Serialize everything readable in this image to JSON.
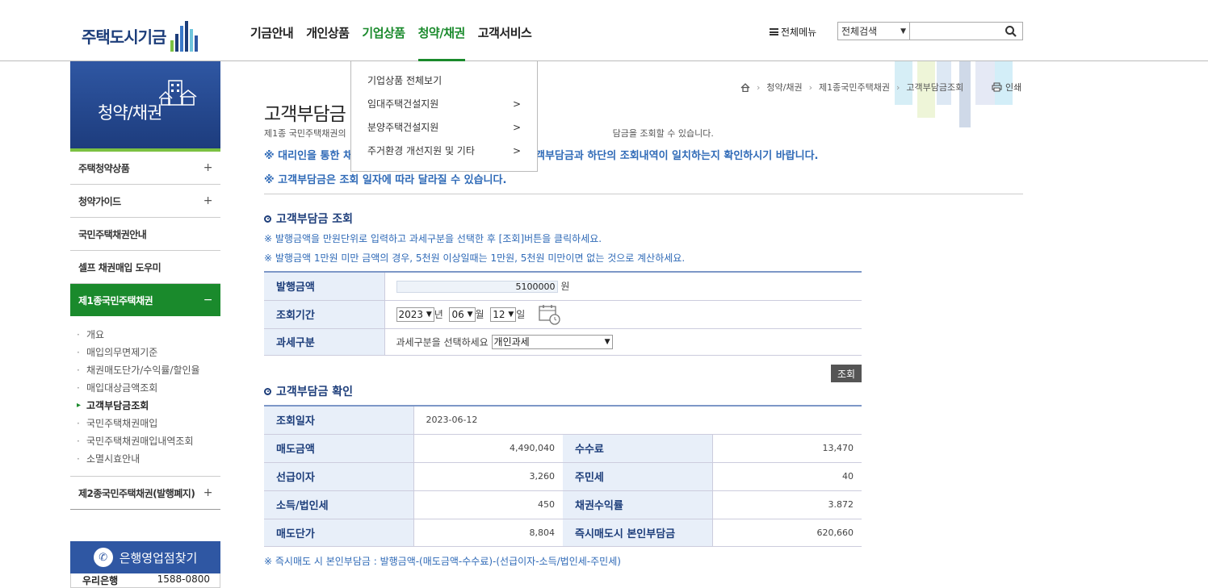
{
  "gnb": {
    "logo": "주택도시기금",
    "menu": [
      "기금안내",
      "개인상품",
      "기업상품",
      "청약/채권",
      "고객서비스"
    ],
    "allmenu": "전체메뉴",
    "search_select": "전체검색",
    "search_value": "",
    "colors": {
      "brand": "#1c3d7a",
      "accent": "#1a8a2c"
    }
  },
  "dropdown": {
    "items": [
      {
        "label": "기업상품 전체보기",
        "arrow": ""
      },
      {
        "label": "임대주택건설지원",
        "arrow": ">"
      },
      {
        "label": "분양주택건설지원",
        "arrow": ">"
      },
      {
        "label": "주거환경 개선지원 및 기타",
        "arrow": ">"
      }
    ]
  },
  "lnb": {
    "title": "청약/채권",
    "items": [
      {
        "label": "주택청약상품",
        "sign": "+"
      },
      {
        "label": "청약가이드",
        "sign": "+"
      },
      {
        "label": "국민주택채권안내",
        "sign": ""
      },
      {
        "label": "셀프 채권매입 도우미",
        "sign": ""
      }
    ],
    "active": {
      "label": "제1종국민주택채권",
      "sign": "−"
    },
    "sub": [
      "개요",
      "매입의무면제기준",
      "채권매도단가/수익률/할인율",
      "매입대상금액조회",
      "고객부담금조회",
      "국민주택채권매입",
      "국민주택채권매입내역조회",
      "소멸시효안내"
    ],
    "last": {
      "label": "제2종국민주택채권(발행폐지)",
      "sign": "+"
    }
  },
  "bank": {
    "title": "은행영업점찾기",
    "row_name": "우리은행",
    "row_phone": "1588-0800"
  },
  "breadcrumb": {
    "items": [
      "청약/채권",
      "제1종국민주택채권",
      "고객부담금조회"
    ],
    "print": "인쇄"
  },
  "page": {
    "title": "고객부담금",
    "desc_a": "제1종 국민주택채권의",
    "desc_b": "담금을 조회할 수 있습니다.",
    "note1_a": "※ 대리인을 통한 채",
    "note1_b": "객부담금과 하단의 조회내역이 일치하는지 확인하시기 바랍니다.",
    "note2": "※ 고객부담금은 조회 일자에 따라 달라질 수 있습니다."
  },
  "query": {
    "section_title": "고객부담금 조회",
    "inst1": "※ 발행금액을 만원단위로 입력하고 과세구분을 선택한 후 [조회]버튼을 클릭하세요.",
    "inst2": "※ 발행금액 1만원 미만 금액의 경우, 5천원 이상일때는 1만원, 5천원 미만이면 없는 것으로 계산하세요.",
    "amount_label": "발행금액",
    "amount_value": "5100000",
    "amount_unit": "원",
    "period_label": "조회기간",
    "year": "2023",
    "year_unit": "년",
    "month": "06",
    "month_unit": "월",
    "day": "12",
    "day_unit": "일",
    "tax_label": "과세구분",
    "tax_hint": "과세구분을 선택하세요",
    "tax_value": "개인과세",
    "button": "조회"
  },
  "result": {
    "section_title": "고객부담금 확인",
    "date_label": "조회일자",
    "date": "2023-06-12",
    "rows": [
      {
        "l1": "매도금액",
        "v1": "4,490,040",
        "l2": "수수료",
        "v2": "13,470"
      },
      {
        "l1": "선급이자",
        "v1": "3,260",
        "l2": "주민세",
        "v2": "40"
      },
      {
        "l1": "소득/법인세",
        "v1": "450",
        "l2": "채권수익률",
        "v2": "3.872"
      },
      {
        "l1": "매도단가",
        "v1": "8,804",
        "l2": "즉시매도시 본인부담금",
        "v2": "620,660"
      }
    ],
    "formula": "※ 즉시매도 시 본인부담금 : 발행금액-(매도금액-수수료)-(선급이자-소득/법인세-주민세)"
  }
}
